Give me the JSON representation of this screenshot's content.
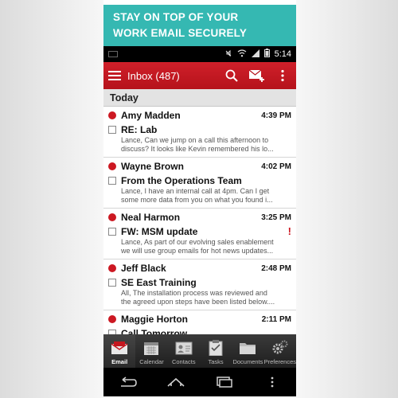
{
  "banner": {
    "line1": "STAY ON TOP OF YOUR",
    "line2": "WORK EMAIL SECURELY"
  },
  "status_bar": {
    "time": "5:14"
  },
  "app_bar": {
    "title": "Inbox (487)"
  },
  "section": {
    "label": "Today"
  },
  "emails": [
    {
      "sender": "Amy Madden",
      "time": "4:39 PM",
      "subject": "RE: Lab",
      "preview1": "Lance, Can we jump on a call this afternoon to",
      "preview2": "discuss? It looks like Kevin remembered his lo...",
      "unread": true,
      "flagged": false
    },
    {
      "sender": "Wayne Brown",
      "time": "4:02 PM",
      "subject": "From the Operations Team",
      "preview1": "Lance, I have an internal call at 4pm. Can I get",
      "preview2": "some more data from you on what you found i...",
      "unread": true,
      "flagged": false
    },
    {
      "sender": "Neal Harmon",
      "time": "3:25 PM",
      "subject": "FW: MSM update",
      "preview1": "Lance, As part of our evolving sales enablement",
      "preview2": "we will use group emails for hot news updates...",
      "unread": true,
      "flagged": true,
      "flag_text": "!"
    },
    {
      "sender": "Jeff Black",
      "time": "2:48 PM",
      "subject": "SE East Training",
      "preview1": "All, The installation process was reviewed and",
      "preview2": "the agreed upon steps have been listed below....",
      "unread": true,
      "flagged": false
    },
    {
      "sender": "Maggie Horton",
      "time": "2:11 PM",
      "subject": "Call Tomorrow",
      "preview1": "",
      "preview2": "",
      "unread": true,
      "flagged": false
    }
  ],
  "tabs": [
    {
      "label": "Email",
      "icon": "email-icon",
      "active": true
    },
    {
      "label": "Calendar",
      "icon": "calendar-icon",
      "active": false
    },
    {
      "label": "Contacts",
      "icon": "contacts-icon",
      "active": false
    },
    {
      "label": "Tasks",
      "icon": "tasks-icon",
      "active": false
    },
    {
      "label": "Documents",
      "icon": "documents-icon",
      "active": false
    },
    {
      "label": "Preferences",
      "icon": "preferences-icon",
      "active": false
    }
  ],
  "colors": {
    "accent": "#c4161f",
    "banner": "#35b8b2",
    "unread_dot": "#cc1822"
  }
}
